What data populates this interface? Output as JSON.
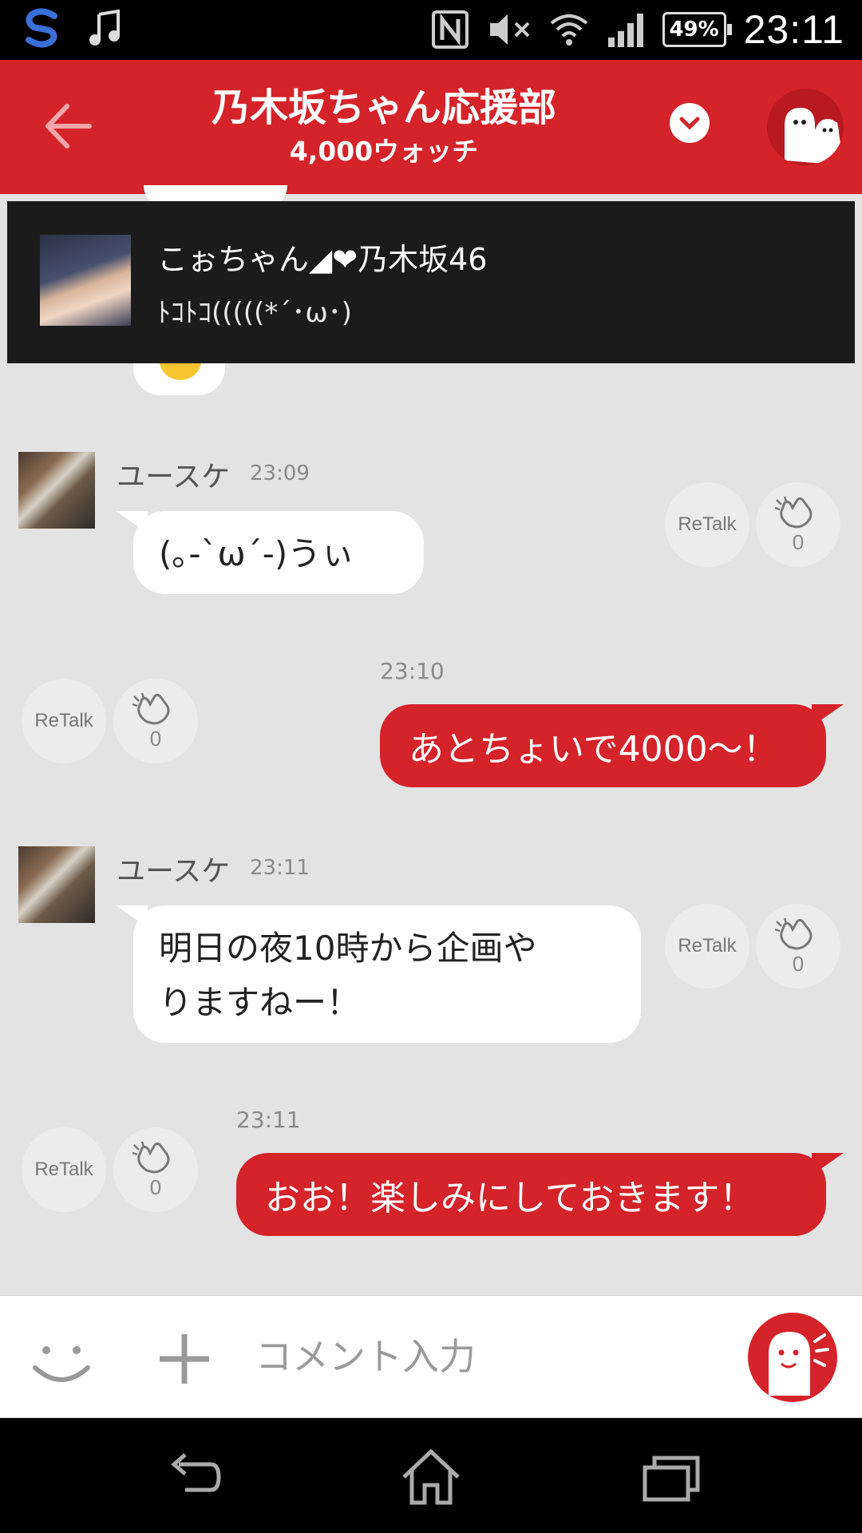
{
  "status_bar": {
    "battery": "49%",
    "time": "23:11"
  },
  "header": {
    "title": "乃木坂ちゃん応援部",
    "subtitle": "4,000ウォッチ"
  },
  "notification": {
    "name": "こぉちゃん◢❤乃木坂46",
    "message": "ﾄｺﾄｺ(((((*´･ω･)"
  },
  "messages": [
    {
      "sender": "ユースケ",
      "time": "23:09",
      "text": "(｡-`ω´-)うぃ",
      "retalk": "ReTalk",
      "claps": "0"
    },
    {
      "time": "23:10",
      "text": "あとちょいで4000〜！",
      "retalk": "ReTalk",
      "claps": "0"
    },
    {
      "sender": "ユースケ",
      "time": "23:11",
      "lines": [
        "明日の夜10時から企画や",
        "りますねー！"
      ],
      "retalk": "ReTalk",
      "claps": "0"
    },
    {
      "time": "23:11",
      "text": "おお！楽しみにしておきます！",
      "retalk": "ReTalk",
      "claps": "0"
    }
  ],
  "input": {
    "placeholder": "コメント入力"
  },
  "colors": {
    "brand_red": "#d5232a",
    "background": "#e3e3e3"
  }
}
